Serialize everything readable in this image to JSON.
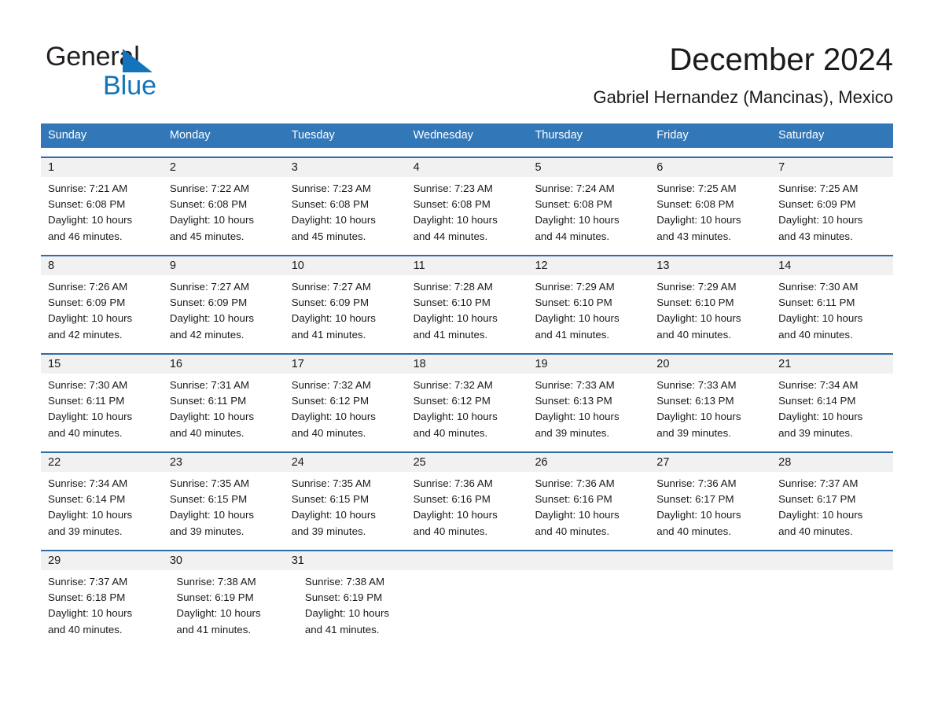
{
  "logo": {
    "word_one": "General",
    "word_two": "Blue",
    "triangle_icon": "blue-triangle-icon",
    "colors": {
      "black": "#231f20",
      "blue": "#1275bc"
    }
  },
  "header": {
    "title": "December 2024",
    "subtitle": "Gabriel Hernandez (Mancinas), Mexico"
  },
  "theme": {
    "header_blue": "#3277b8",
    "rule_blue": "#2e6da8",
    "daynum_band": "#f1f1f1",
    "text": "#1a1a1a"
  },
  "weekdays": [
    "Sunday",
    "Monday",
    "Tuesday",
    "Wednesday",
    "Thursday",
    "Friday",
    "Saturday"
  ],
  "weeks": [
    [
      {
        "day": "1",
        "lines": [
          "Sunrise: 7:21 AM",
          "Sunset: 6:08 PM",
          "Daylight: 10 hours",
          "and 46 minutes."
        ]
      },
      {
        "day": "2",
        "lines": [
          "Sunrise: 7:22 AM",
          "Sunset: 6:08 PM",
          "Daylight: 10 hours",
          "and 45 minutes."
        ]
      },
      {
        "day": "3",
        "lines": [
          "Sunrise: 7:23 AM",
          "Sunset: 6:08 PM",
          "Daylight: 10 hours",
          "and 45 minutes."
        ]
      },
      {
        "day": "4",
        "lines": [
          "Sunrise: 7:23 AM",
          "Sunset: 6:08 PM",
          "Daylight: 10 hours",
          "and 44 minutes."
        ]
      },
      {
        "day": "5",
        "lines": [
          "Sunrise: 7:24 AM",
          "Sunset: 6:08 PM",
          "Daylight: 10 hours",
          "and 44 minutes."
        ]
      },
      {
        "day": "6",
        "lines": [
          "Sunrise: 7:25 AM",
          "Sunset: 6:08 PM",
          "Daylight: 10 hours",
          "and 43 minutes."
        ]
      },
      {
        "day": "7",
        "lines": [
          "Sunrise: 7:25 AM",
          "Sunset: 6:09 PM",
          "Daylight: 10 hours",
          "and 43 minutes."
        ]
      }
    ],
    [
      {
        "day": "8",
        "lines": [
          "Sunrise: 7:26 AM",
          "Sunset: 6:09 PM",
          "Daylight: 10 hours",
          "and 42 minutes."
        ]
      },
      {
        "day": "9",
        "lines": [
          "Sunrise: 7:27 AM",
          "Sunset: 6:09 PM",
          "Daylight: 10 hours",
          "and 42 minutes."
        ]
      },
      {
        "day": "10",
        "lines": [
          "Sunrise: 7:27 AM",
          "Sunset: 6:09 PM",
          "Daylight: 10 hours",
          "and 41 minutes."
        ]
      },
      {
        "day": "11",
        "lines": [
          "Sunrise: 7:28 AM",
          "Sunset: 6:10 PM",
          "Daylight: 10 hours",
          "and 41 minutes."
        ]
      },
      {
        "day": "12",
        "lines": [
          "Sunrise: 7:29 AM",
          "Sunset: 6:10 PM",
          "Daylight: 10 hours",
          "and 41 minutes."
        ]
      },
      {
        "day": "13",
        "lines": [
          "Sunrise: 7:29 AM",
          "Sunset: 6:10 PM",
          "Daylight: 10 hours",
          "and 40 minutes."
        ]
      },
      {
        "day": "14",
        "lines": [
          "Sunrise: 7:30 AM",
          "Sunset: 6:11 PM",
          "Daylight: 10 hours",
          "and 40 minutes."
        ]
      }
    ],
    [
      {
        "day": "15",
        "lines": [
          "Sunrise: 7:30 AM",
          "Sunset: 6:11 PM",
          "Daylight: 10 hours",
          "and 40 minutes."
        ]
      },
      {
        "day": "16",
        "lines": [
          "Sunrise: 7:31 AM",
          "Sunset: 6:11 PM",
          "Daylight: 10 hours",
          "and 40 minutes."
        ]
      },
      {
        "day": "17",
        "lines": [
          "Sunrise: 7:32 AM",
          "Sunset: 6:12 PM",
          "Daylight: 10 hours",
          "and 40 minutes."
        ]
      },
      {
        "day": "18",
        "lines": [
          "Sunrise: 7:32 AM",
          "Sunset: 6:12 PM",
          "Daylight: 10 hours",
          "and 40 minutes."
        ]
      },
      {
        "day": "19",
        "lines": [
          "Sunrise: 7:33 AM",
          "Sunset: 6:13 PM",
          "Daylight: 10 hours",
          "and 39 minutes."
        ]
      },
      {
        "day": "20",
        "lines": [
          "Sunrise: 7:33 AM",
          "Sunset: 6:13 PM",
          "Daylight: 10 hours",
          "and 39 minutes."
        ]
      },
      {
        "day": "21",
        "lines": [
          "Sunrise: 7:34 AM",
          "Sunset: 6:14 PM",
          "Daylight: 10 hours",
          "and 39 minutes."
        ]
      }
    ],
    [
      {
        "day": "22",
        "lines": [
          "Sunrise: 7:34 AM",
          "Sunset: 6:14 PM",
          "Daylight: 10 hours",
          "and 39 minutes."
        ]
      },
      {
        "day": "23",
        "lines": [
          "Sunrise: 7:35 AM",
          "Sunset: 6:15 PM",
          "Daylight: 10 hours",
          "and 39 minutes."
        ]
      },
      {
        "day": "24",
        "lines": [
          "Sunrise: 7:35 AM",
          "Sunset: 6:15 PM",
          "Daylight: 10 hours",
          "and 39 minutes."
        ]
      },
      {
        "day": "25",
        "lines": [
          "Sunrise: 7:36 AM",
          "Sunset: 6:16 PM",
          "Daylight: 10 hours",
          "and 40 minutes."
        ]
      },
      {
        "day": "26",
        "lines": [
          "Sunrise: 7:36 AM",
          "Sunset: 6:16 PM",
          "Daylight: 10 hours",
          "and 40 minutes."
        ]
      },
      {
        "day": "27",
        "lines": [
          "Sunrise: 7:36 AM",
          "Sunset: 6:17 PM",
          "Daylight: 10 hours",
          "and 40 minutes."
        ]
      },
      {
        "day": "28",
        "lines": [
          "Sunrise: 7:37 AM",
          "Sunset: 6:17 PM",
          "Daylight: 10 hours",
          "and 40 minutes."
        ]
      }
    ],
    [
      {
        "day": "29",
        "lines": [
          "Sunrise: 7:37 AM",
          "Sunset: 6:18 PM",
          "Daylight: 10 hours",
          "and 40 minutes."
        ]
      },
      {
        "day": "30",
        "lines": [
          "Sunrise: 7:38 AM",
          "Sunset: 6:19 PM",
          "Daylight: 10 hours",
          "and 41 minutes."
        ]
      },
      {
        "day": "31",
        "lines": [
          "Sunrise: 7:38 AM",
          "Sunset: 6:19 PM",
          "Daylight: 10 hours",
          "and 41 minutes."
        ]
      },
      {
        "day": "",
        "lines": []
      },
      {
        "day": "",
        "lines": []
      },
      {
        "day": "",
        "lines": []
      },
      {
        "day": "",
        "lines": []
      }
    ]
  ]
}
